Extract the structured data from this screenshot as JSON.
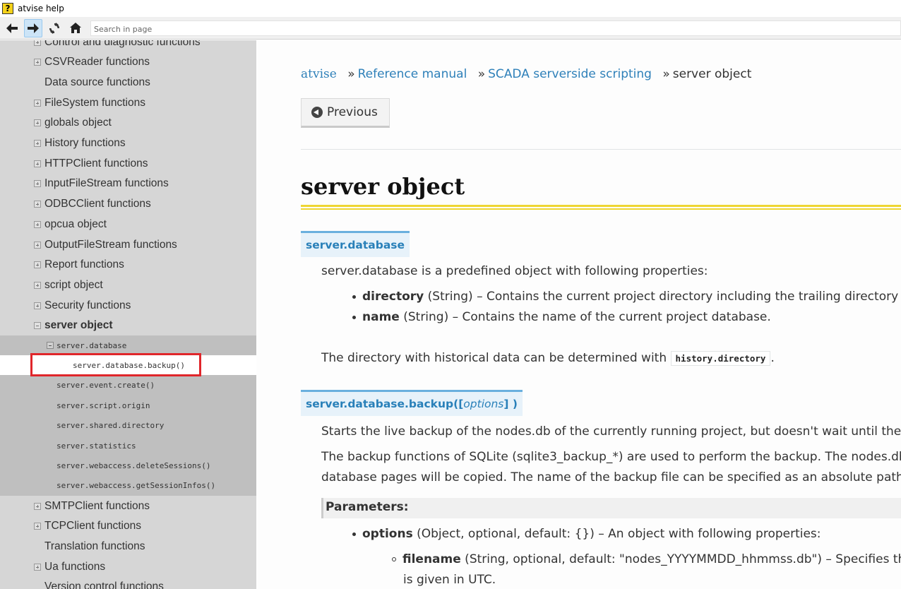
{
  "window": {
    "title": "atvise help",
    "icon_glyph": "?"
  },
  "toolbar": {
    "back_icon": "arrow-left-icon",
    "forward_icon": "arrow-right-icon",
    "refresh_icon": "refresh-icon",
    "home_icon": "home-icon",
    "search_placeholder": "Search in page"
  },
  "sidebar": {
    "items": [
      {
        "label": "Control and diagnostic functions",
        "expander": "plus"
      },
      {
        "label": "CSVReader functions",
        "expander": "plus"
      },
      {
        "label": "Data source functions",
        "expander": "none"
      },
      {
        "label": "FileSystem functions",
        "expander": "plus"
      },
      {
        "label": "globals object",
        "expander": "plus"
      },
      {
        "label": "History functions",
        "expander": "plus"
      },
      {
        "label": "HTTPClient functions",
        "expander": "plus"
      },
      {
        "label": "InputFileStream functions",
        "expander": "plus"
      },
      {
        "label": "ODBCClient functions",
        "expander": "plus"
      },
      {
        "label": "opcua object",
        "expander": "plus"
      },
      {
        "label": "OutputFileStream functions",
        "expander": "plus"
      },
      {
        "label": "Report functions",
        "expander": "plus"
      },
      {
        "label": "script object",
        "expander": "plus"
      },
      {
        "label": "Security functions",
        "expander": "plus"
      },
      {
        "label": "server object",
        "expander": "minus"
      }
    ],
    "sub_items": [
      {
        "label": "server.database",
        "expander": "minus"
      },
      {
        "label": "server.database.backup()",
        "selected": true
      },
      {
        "label": "server.event.create()"
      },
      {
        "label": "server.script.origin"
      },
      {
        "label": "server.shared.directory"
      },
      {
        "label": "server.statistics"
      },
      {
        "label": "server.webaccess.deleteSessions()"
      },
      {
        "label": "server.webaccess.getSessionInfos()"
      }
    ],
    "items_after": [
      {
        "label": "SMTPClient functions",
        "expander": "plus"
      },
      {
        "label": "TCPClient functions",
        "expander": "plus"
      },
      {
        "label": "Translation functions",
        "expander": "none"
      },
      {
        "label": "Ua functions",
        "expander": "plus"
      },
      {
        "label": "Version control functions",
        "expander": "none"
      }
    ]
  },
  "breadcrumb": {
    "brand": "atvise",
    "sep": "»",
    "link1": "Reference manual",
    "link2": "SCADA serverside scripting",
    "current": "server object"
  },
  "nav": {
    "previous_label": "Previous"
  },
  "content": {
    "title": "server object",
    "section1": {
      "signature": "server.database",
      "intro": "server.database is a predefined object with following properties:",
      "prop1_name": "directory",
      "prop1_desc": " (String) – Contains the current project directory including the trailing directory se",
      "prop2_name": "name",
      "prop2_desc": " (String) – Contains the name of the current project database.",
      "hist_text": "The directory with historical data can be determined with ",
      "hist_code": "history.directory",
      "hist_end": "."
    },
    "section2": {
      "signature_name": "server.database.backup(",
      "signature_open": " [ ",
      "signature_param": "options",
      "signature_close": " ] )",
      "para1": "Starts the live backup of the nodes.db of the currently running project, but doesn't wait until the b",
      "para2_line1": "The backup functions of SQLite (sqlite3_backup_*) are used to perform the backup. The nodes.db",
      "para2_line2": "database pages will be copied. The name of the backup file can be specified as an absolute path o",
      "params_heading": "Parameters:",
      "param1_name": "options",
      "param1_desc": " (Object, optional, default: {}) – An object with following properties:",
      "subparam1_name": "filename",
      "subparam1_desc": " (String, optional, default: \"nodes_YYYYMMDD_hhmmss.db\") – Specifies th",
      "subparam1_cont": "is given in UTC."
    }
  }
}
